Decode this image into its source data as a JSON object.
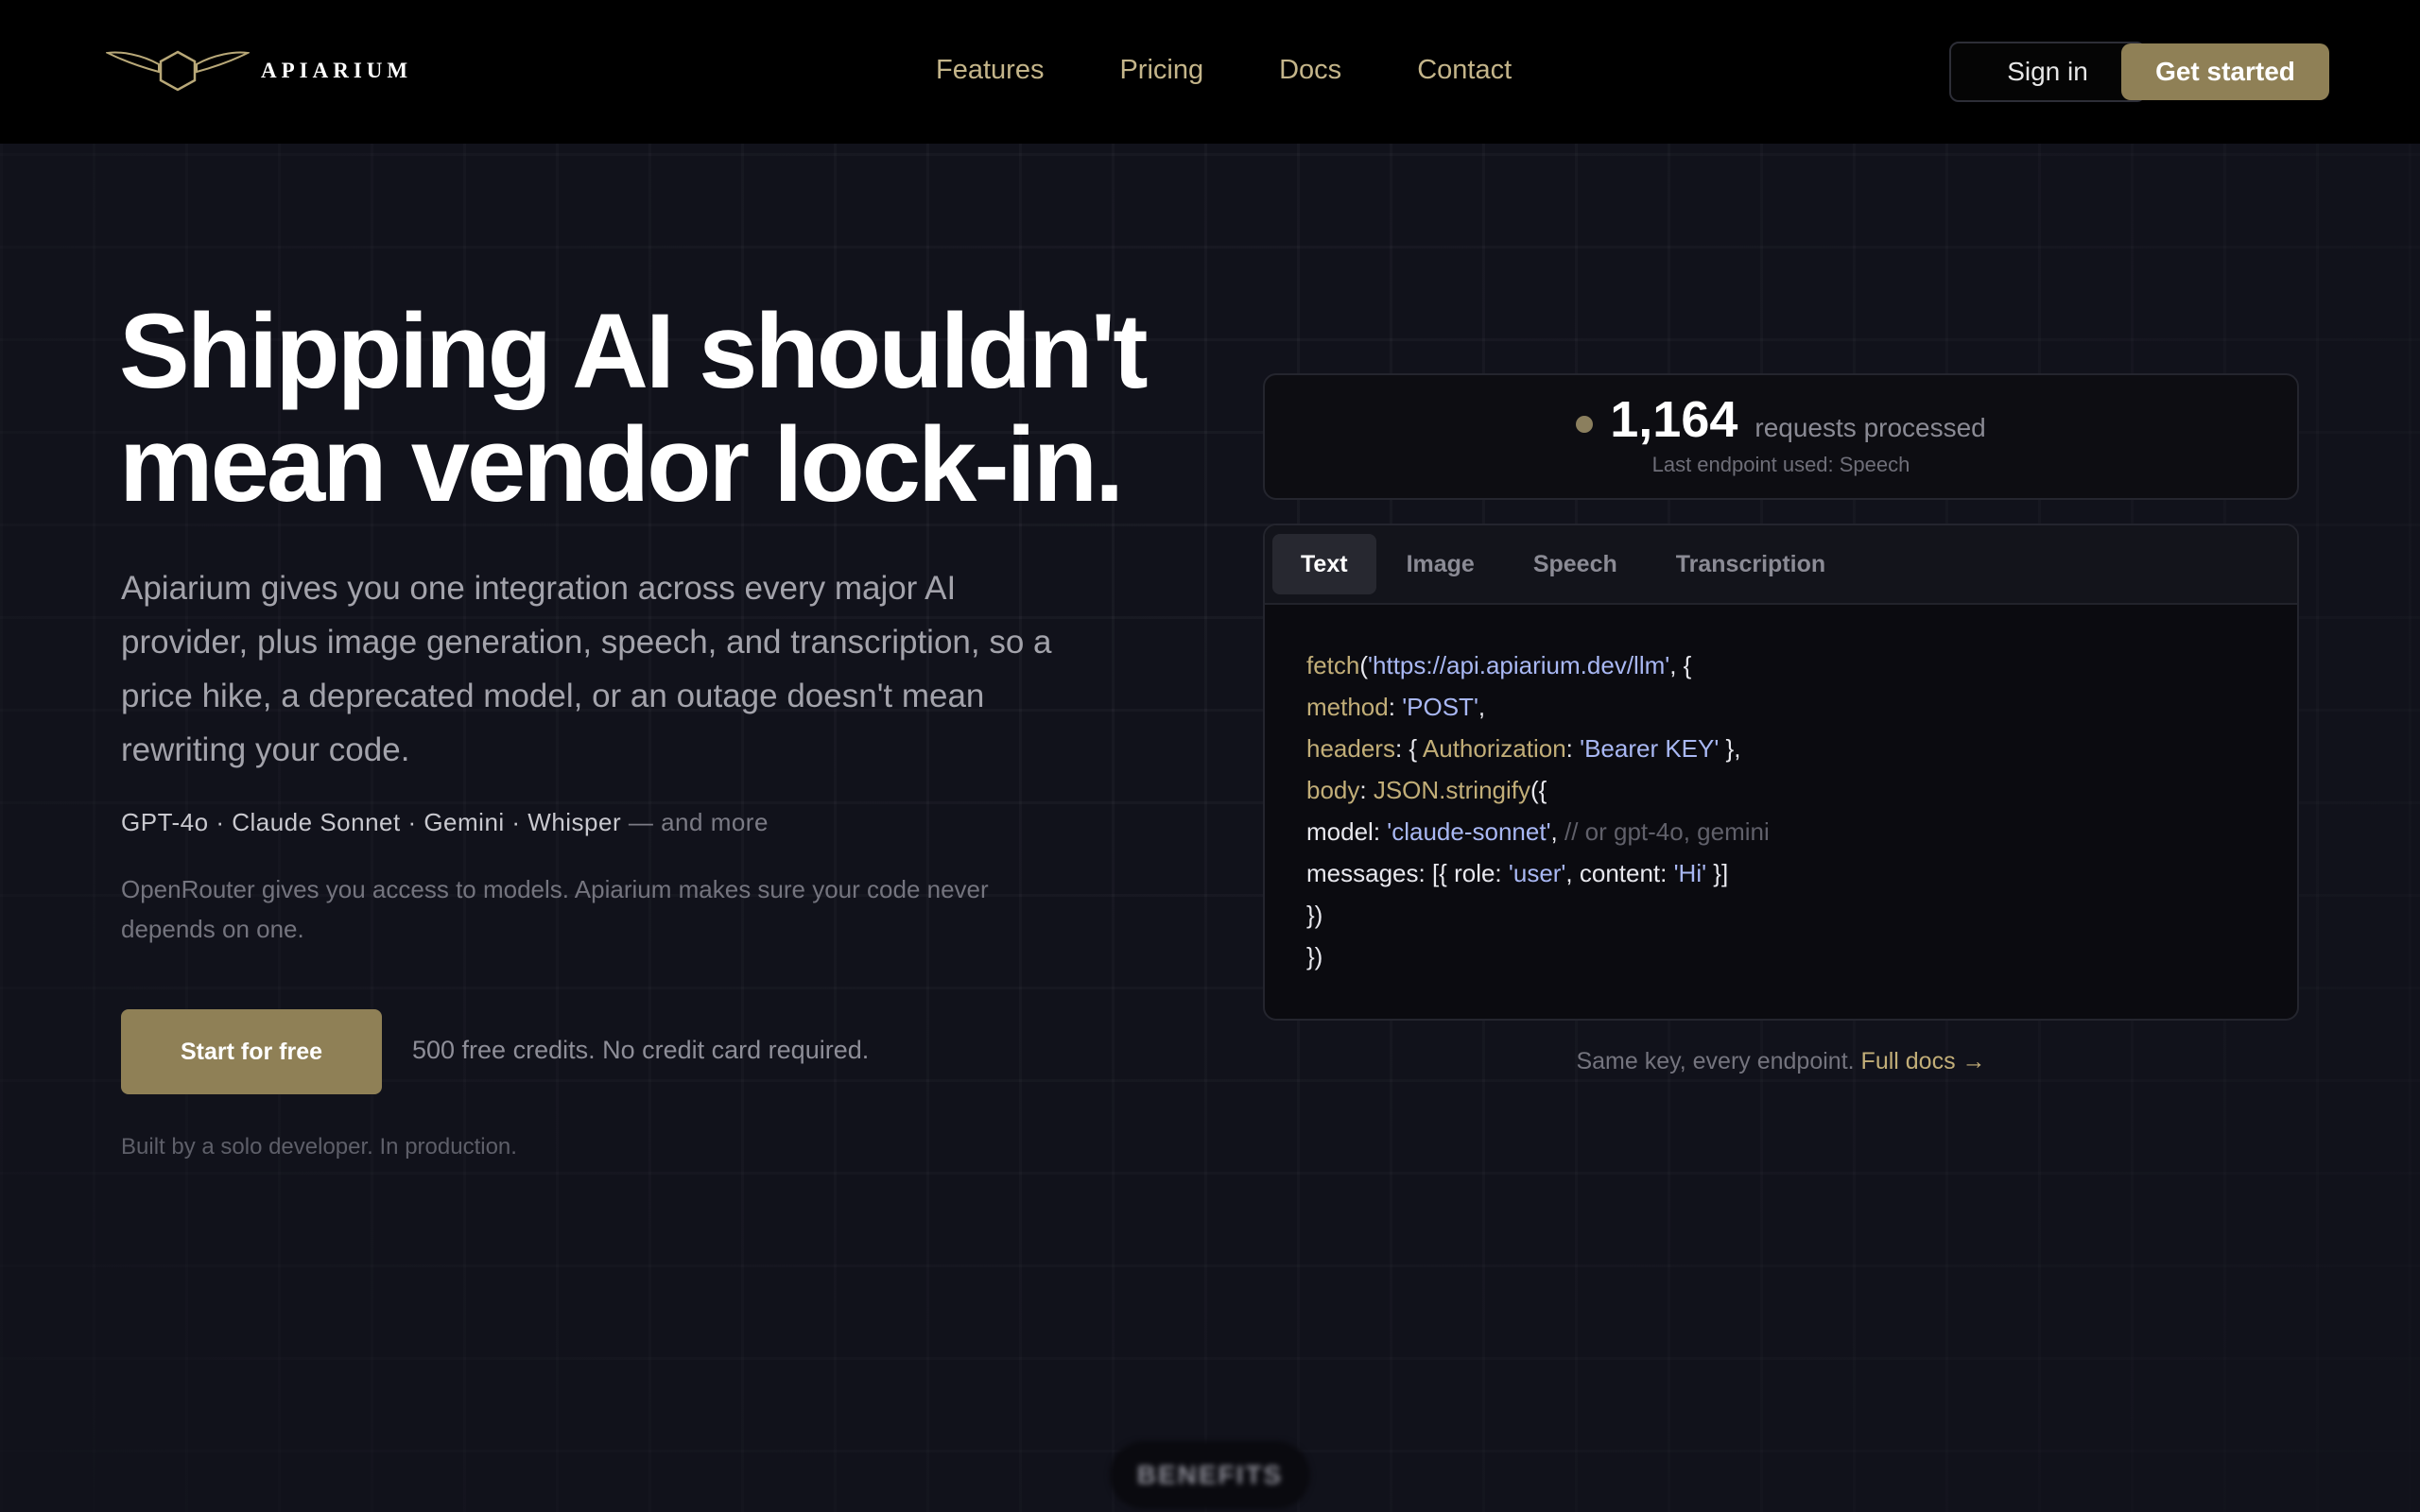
{
  "brand": {
    "name": "APIARIUM",
    "accent": "#8f8056",
    "accent_text": "#c2ae78"
  },
  "nav": {
    "links": [
      "Features",
      "Pricing",
      "Docs",
      "Contact"
    ],
    "sign_in": "Sign in",
    "get_started": "Get started"
  },
  "hero": {
    "title_line1": "Shipping AI shouldn't",
    "title_line2": "mean vendor lock-in.",
    "description": "Apiarium gives you one integration across every major AI provider, plus image generation, speech, and transcription, so a price hike, a deprecated model, or an outage doesn't mean rewriting your code.",
    "models": "GPT-4o · Claude Sonnet · Gemini · Whisper",
    "models_more": " — and more",
    "openrouter_note": "OpenRouter gives you access to models. Apiarium makes sure your code never depends on one.",
    "cta": "Start for free",
    "credits_note": "500 free credits. No credit card required.",
    "built_by": "Built by a solo developer. In production."
  },
  "stats": {
    "count": "1,164",
    "label": "requests processed",
    "sub": "Last endpoint used: Speech"
  },
  "code_panel": {
    "tabs": [
      "Text",
      "Image",
      "Speech",
      "Transcription"
    ],
    "active_tab": "Text",
    "lines": [
      [
        {
          "t": "k",
          "v": "fetch"
        },
        {
          "t": "p",
          "v": "("
        },
        {
          "t": "s",
          "v": "'https://api.apiarium.dev/llm'"
        },
        {
          "t": "p",
          "v": ", {"
        }
      ],
      [
        {
          "t": "k",
          "v": "method"
        },
        {
          "t": "p",
          "v": ": "
        },
        {
          "t": "s",
          "v": "'POST'"
        },
        {
          "t": "p",
          "v": ","
        }
      ],
      [
        {
          "t": "k",
          "v": "headers"
        },
        {
          "t": "p",
          "v": ": { "
        },
        {
          "t": "k",
          "v": "Authorization"
        },
        {
          "t": "p",
          "v": ": "
        },
        {
          "t": "s",
          "v": "'Bearer KEY'"
        },
        {
          "t": "p",
          "v": " },"
        }
      ],
      [
        {
          "t": "k",
          "v": "body"
        },
        {
          "t": "p",
          "v": ": "
        },
        {
          "t": "k",
          "v": "JSON.stringify"
        },
        {
          "t": "p",
          "v": "({"
        }
      ],
      [
        {
          "t": "p",
          "v": "model: "
        },
        {
          "t": "s",
          "v": "'claude-sonnet'"
        },
        {
          "t": "p",
          "v": ", "
        },
        {
          "t": "c",
          "v": "// or gpt-4o, gemini"
        }
      ],
      [
        {
          "t": "p",
          "v": "messages: [{ role: "
        },
        {
          "t": "s",
          "v": "'user'"
        },
        {
          "t": "p",
          "v": ", content: "
        },
        {
          "t": "s",
          "v": "'Hi'"
        },
        {
          "t": "p",
          "v": " }]"
        }
      ],
      [
        {
          "t": "p",
          "v": "})"
        }
      ],
      [
        {
          "t": "p",
          "v": "})"
        }
      ]
    ],
    "footer_text": "Same key, every endpoint. ",
    "footer_link": "Full docs →"
  },
  "benefits_label": "BENEFITS"
}
